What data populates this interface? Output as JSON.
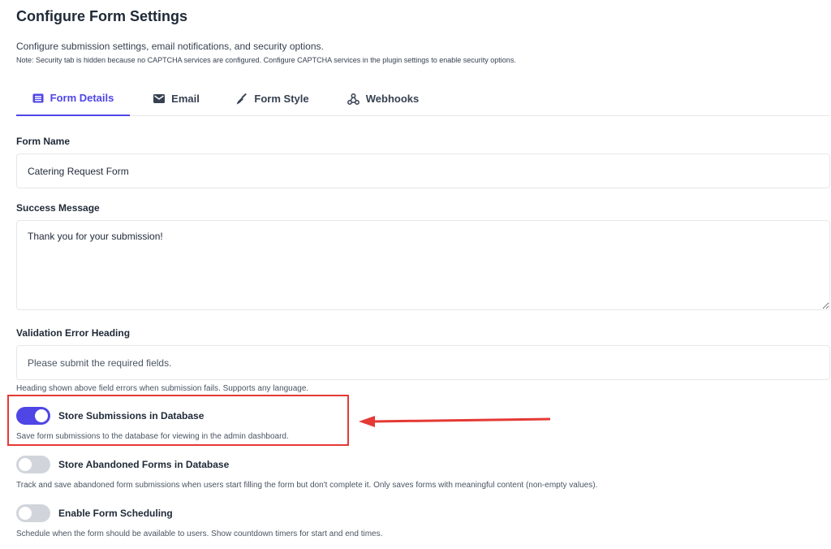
{
  "header": {
    "title": "Configure Form Settings",
    "description": "Configure submission settings, email notifications, and security options.",
    "note": "Note: Security tab is hidden because no CAPTCHA services are configured. Configure CAPTCHA services in the plugin settings to enable security options."
  },
  "tabs": [
    {
      "label": "Form Details",
      "icon": "form-list-icon",
      "active": true
    },
    {
      "label": "Email",
      "icon": "envelope-icon",
      "active": false
    },
    {
      "label": "Form Style",
      "icon": "brush-icon",
      "active": false
    },
    {
      "label": "Webhooks",
      "icon": "webhook-icon",
      "active": false
    }
  ],
  "form": {
    "form_name": {
      "label": "Form Name",
      "value": "Catering Request Form"
    },
    "success_message": {
      "label": "Success Message",
      "value": "Thank you for your submission!"
    },
    "validation_error_heading": {
      "label": "Validation Error Heading",
      "placeholder": "Please submit the required fields.",
      "help": "Heading shown above field errors when submission fails. Supports any language."
    }
  },
  "toggles": [
    {
      "label": "Store Submissions in Database",
      "checked": true,
      "help": "Save form submissions to the database for viewing in the admin dashboard."
    },
    {
      "label": "Store Abandoned Forms in Database",
      "checked": false,
      "help": "Track and save abandoned form submissions when users start filling the form but don't complete it. Only saves forms with meaningful content (non-empty values)."
    },
    {
      "label": "Enable Form Scheduling",
      "checked": false,
      "help": "Schedule when the form should be available to users. Show countdown timers for start and end times."
    }
  ],
  "colors": {
    "accent": "#4f46e5",
    "annotation": "#e53935",
    "toggle_off": "#d1d5db"
  }
}
